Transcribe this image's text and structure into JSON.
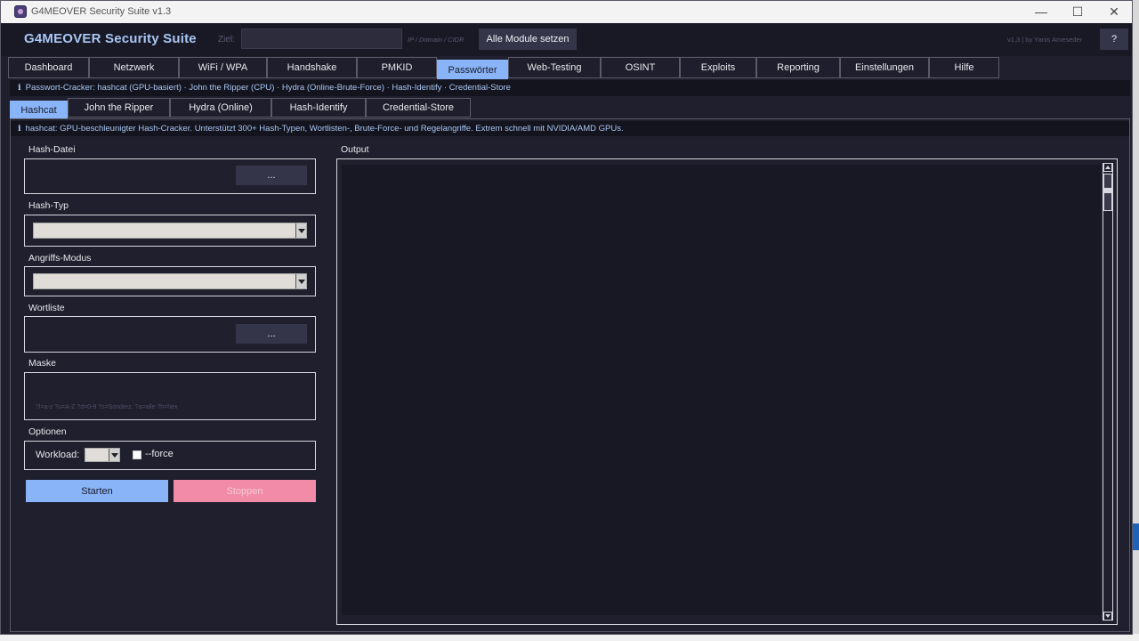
{
  "window": {
    "title": "G4MEOVER Security Suite  v1.3",
    "minimize": "—",
    "maximize": "☐",
    "close": "✕"
  },
  "header": {
    "brand": "G4MEOVER Security Suite",
    "ziel_label": "Ziel:",
    "ziel_value": "",
    "ziel_hint": "IP / Domain / CIDR",
    "set_all_label": "Alle Module setzen",
    "version": "v1.3  |  by Yanis Ameseder",
    "help_label": "?"
  },
  "main_tabs": [
    {
      "label": "Dashboard",
      "active": false
    },
    {
      "label": "Netzwerk",
      "active": false
    },
    {
      "label": "WiFi / WPA",
      "active": false
    },
    {
      "label": "Handshake",
      "active": false
    },
    {
      "label": "PMKID",
      "active": false
    },
    {
      "label": "Passwörter",
      "active": true
    },
    {
      "label": "Web-Testing",
      "active": false
    },
    {
      "label": "OSINT",
      "active": false
    },
    {
      "label": "Exploits",
      "active": false
    },
    {
      "label": "Reporting",
      "active": false
    },
    {
      "label": "Einstellungen",
      "active": false
    },
    {
      "label": "Hilfe",
      "active": false
    }
  ],
  "info_icon": "i",
  "module_info": "Passwort-Cracker: hashcat (GPU-basiert) · John the Ripper (CPU) · Hydra (Online-Brute-Force) · Hash-Identify · Credential-Store",
  "sub_tabs": [
    {
      "label": "Hashcat",
      "active": true
    },
    {
      "label": "John the Ripper",
      "active": false
    },
    {
      "label": "Hydra (Online)",
      "active": false
    },
    {
      "label": "Hash-Identify",
      "active": false
    },
    {
      "label": "Credential-Store",
      "active": false
    }
  ],
  "hashcat": {
    "info": "hashcat: GPU-beschleunigter Hash-Cracker. Unterstützt 300+ Hash-Typen, Wortlisten-, Brute-Force- und Regelangriffe. Extrem schnell mit NVIDIA/AMD GPUs.",
    "hash_file_label": "Hash-Datei",
    "hash_file_value": "",
    "browse_label": "...",
    "hash_type_label": "Hash-Typ",
    "hash_type_value": "",
    "attack_mode_label": "Angriffs-Modus",
    "attack_mode_value": "",
    "wordlist_label": "Wortliste",
    "wordlist_value": "",
    "mask_label": "Maske",
    "mask_placeholder": "?l=a-z  ?u=A-Z  ?d=0-9  ?s=Sonderz.  ?a=alle  ?h=hex",
    "options_label": "Optionen",
    "workload_label": "Workload:",
    "workload_value": "",
    "force_label": "--force",
    "force_checked": false,
    "start_label": "Starten",
    "stop_label": "Stoppen",
    "output_label": "Output",
    "output_text": ""
  },
  "colors": {
    "accent": "#8ab4f8",
    "stop": "#f28ba8",
    "background": "#1f1f2e",
    "header": "#191926"
  }
}
